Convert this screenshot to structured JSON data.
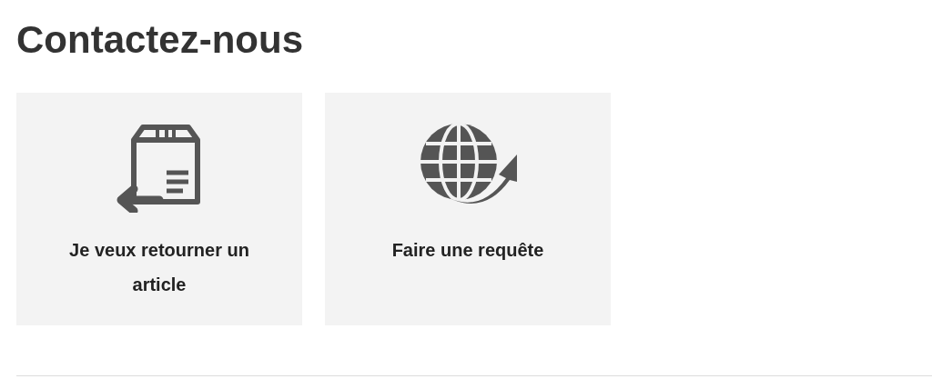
{
  "page": {
    "title": "Contactez-nous"
  },
  "cards": [
    {
      "kind": "return",
      "label": "Je veux retourner un article"
    },
    {
      "kind": "request",
      "label": "Faire une requête"
    }
  ]
}
